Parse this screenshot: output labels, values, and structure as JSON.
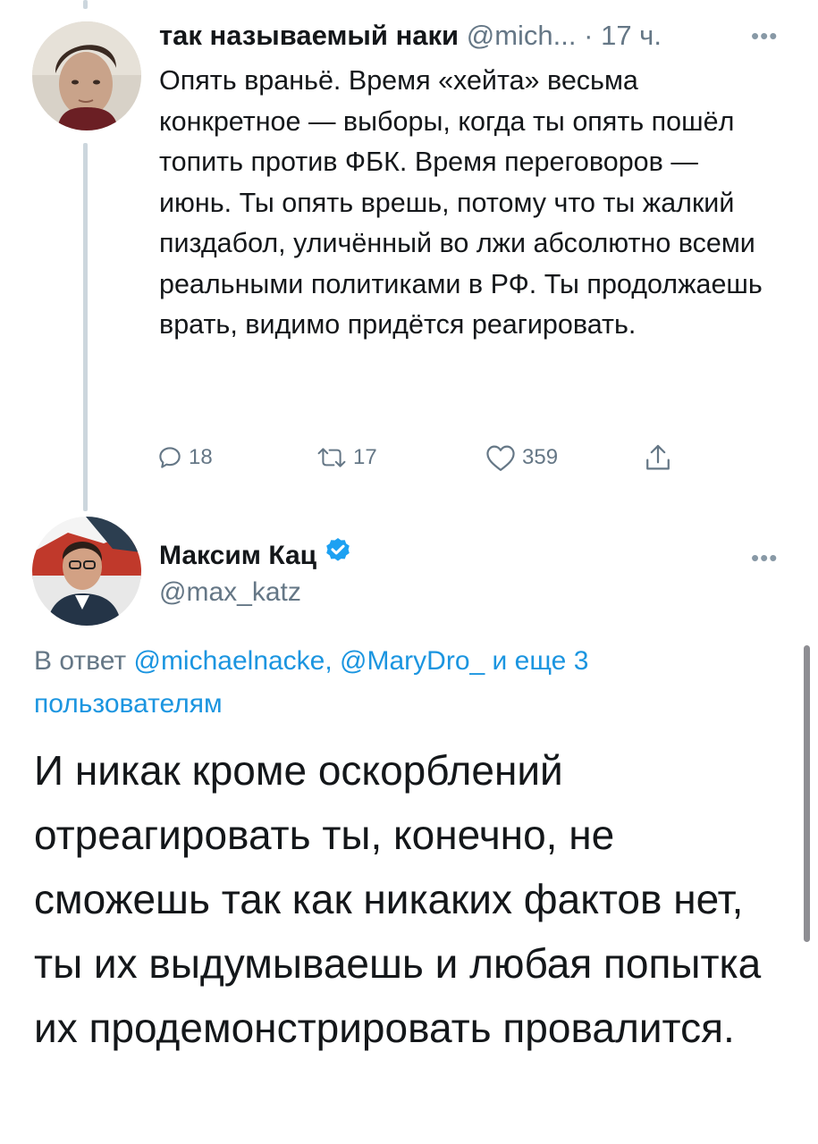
{
  "tweet1": {
    "author_name": "так называемый наки",
    "author_handle": "@mich...",
    "time": "· 17 ч.",
    "text": "Опять враньё. Время «хейта» весьма конкретное — выборы, когда ты опять пошёл топить против ФБК. Время переговоров — июнь. Ты опять врешь, потому что ты жалкий пиздабол, уличённый во лжи абсолютно всеми реальными политиками в РФ. Ты продолжаешь врать, видимо придётся реагировать.",
    "counts": {
      "replies": "18",
      "retweets": "17",
      "likes": "359"
    },
    "icons": {
      "reply": "reply-icon",
      "retweet": "retweet-icon",
      "like": "heart-icon",
      "share": "share-icon",
      "more": "more-icon"
    }
  },
  "tweet2": {
    "author_name": "Максим Кац",
    "author_handle": "@max_katz",
    "reply_prefix": "В ответ",
    "mention_1": "@michaelnacke,",
    "mention_2": "@MaryDro_",
    "reply_suffix": "и еще 3 пользователям",
    "text": "И никак кроме оскорблений отреагировать ты, конечно, не сможешь так как никаких фактов нет, ты их выдумываешь и любая попытка их продемонстрировать провалится.",
    "icons": {
      "verified": "verified-badge-icon",
      "more": "more-icon"
    }
  },
  "colors": {
    "text": "#14171a",
    "secondary": "#657786",
    "link": "#1b95e0",
    "verified": "#1da1f2",
    "thread_line": "#ccd6dd"
  }
}
